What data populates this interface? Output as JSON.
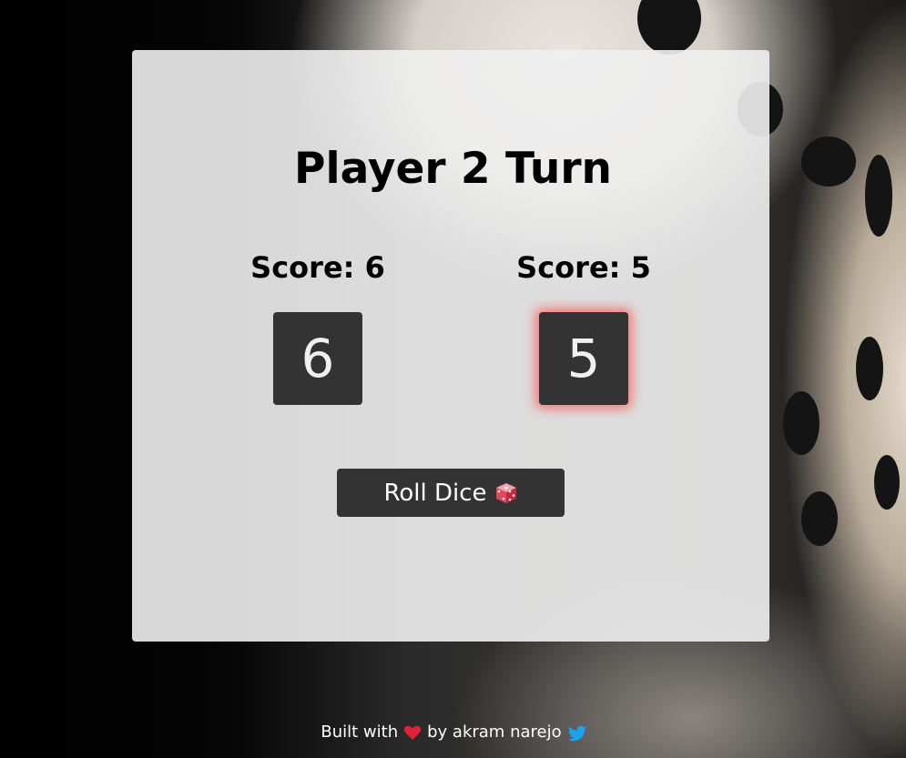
{
  "game": {
    "turn_title": "Player 2 Turn",
    "players": [
      {
        "score_label": "Score: 6",
        "die_value": "6",
        "active": false
      },
      {
        "score_label": "Score: 5",
        "die_value": "5",
        "active": true
      }
    ],
    "roll_button_label": "Roll Dice",
    "roll_button_icon": "game-die-icon"
  },
  "footer": {
    "text_before": "Built with",
    "heart_icon": "heart-icon",
    "text_after": "by akram narejo",
    "twitter_icon": "twitter-icon"
  },
  "colors": {
    "active_glow": "#ff5050",
    "die_bg": "#333333",
    "card_bg": "#f0f0f0"
  }
}
